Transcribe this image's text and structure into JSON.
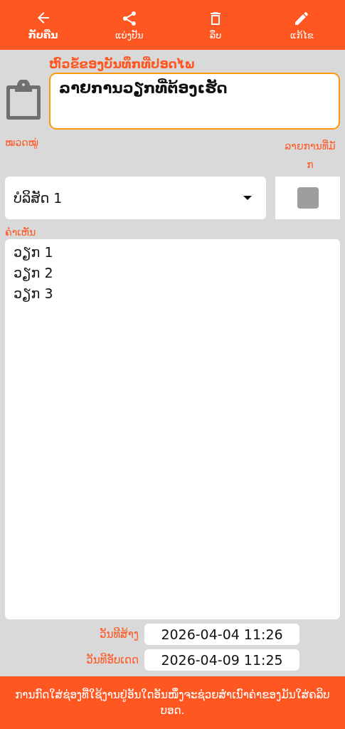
{
  "toolbar": [
    {
      "label": "ກັບຄືນ",
      "kind": "back",
      "selected": true
    },
    {
      "label": "ແບ່ງປັນ",
      "kind": "share",
      "selected": false
    },
    {
      "label": "ລຶບ",
      "kind": "delete",
      "selected": false
    },
    {
      "label": "ແກ້ໄຂ",
      "kind": "edit",
      "selected": false
    }
  ],
  "title_field": {
    "label": "ຫົວຂໍ້ຂອງບັນທຶກທີ່ປອດໄພ",
    "value": "ລາຍການວຽກທີ່ຕ້ອງເຮັດ"
  },
  "category": {
    "label": "ໝວດໝູ່",
    "value": "ບໍລິສັດ 1"
  },
  "favorite": {
    "label": "ລາຍການທີ່ມັກ",
    "checked": false
  },
  "notes": {
    "label": "ຄຳເຫັນ",
    "lines": [
      "ວຽກ 1",
      "ວຽກ 2",
      "ວຽກ 3"
    ]
  },
  "dates": [
    {
      "label": "ວັນທີສ້າງ",
      "value": "2026-04-04 11:26"
    },
    {
      "label": "ວັນທີອັບເດດ",
      "value": "2026-04-09 11:25"
    }
  ],
  "footer": "ການກົດໃສ່ຊ່ອງທີ່ໃຊ້ງານຢູ່ອັນໃດອັນໜຶ່ງຈະຊ່ວຍສຳເນົາຄ່າຂອງມັນໃສ່ຄລິບບອດ."
}
